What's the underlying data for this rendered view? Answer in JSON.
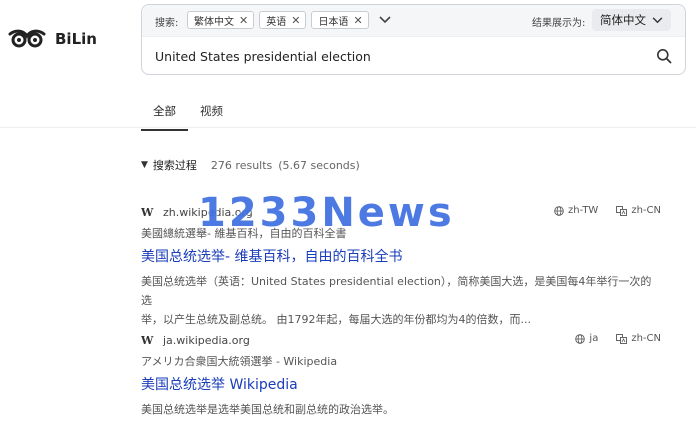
{
  "brand": {
    "name": "BiLin"
  },
  "search": {
    "label": "搜索:",
    "languages": [
      "繁体中文",
      "英语",
      "日本语"
    ],
    "result_lang_label": "结果展示为:",
    "result_lang_value": "简体中文",
    "query": "United States presidential election"
  },
  "tabs": [
    {
      "label": "全部",
      "active": true
    },
    {
      "label": "视频",
      "active": false
    }
  ],
  "process": {
    "label": "搜索过程",
    "count": "276 results",
    "time": "(5.67 seconds)"
  },
  "results": [
    {
      "icon": "W",
      "domain": "zh.wikipedia.org",
      "source_lang": "zh-TW",
      "target_lang": "zh-CN",
      "original_title": "美國總統選舉- 維基百科，自由的百科全書",
      "title": "美国总统选举- 维基百科，自由的百科全书",
      "snippet_line1": "美国总统选举（英语：United States presidential election），简称美国大选，是美国每4年举行一次的选",
      "snippet_line2": "举，以产生总统及副总统。 由1792年起，每届大选的年份都均为4的倍数，而..."
    },
    {
      "icon": "W",
      "domain": "ja.wikipedia.org",
      "source_lang": "ja",
      "target_lang": "zh-CN",
      "original_title": "アメリカ合衆国大統領選挙 - Wikipedia",
      "title": "美国总统选举 Wikipedia",
      "snippet_line1": "美国总统选举是选举美国总统和副总统的政治选举。"
    }
  ],
  "watermark": "1233News",
  "colors": {
    "link": "#1a3dbb",
    "watermark": "#3e6fe0"
  }
}
